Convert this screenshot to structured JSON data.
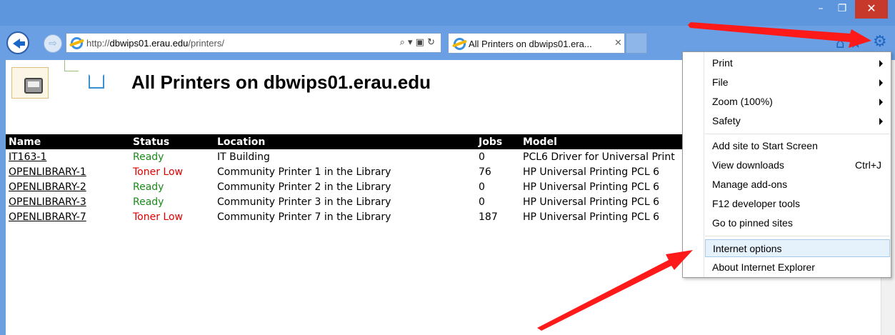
{
  "window": {
    "min_glyph": "–",
    "max_glyph": "❐",
    "close_glyph": "✕"
  },
  "nav": {
    "forward_glyph": "⇨",
    "url_prefix": "http://",
    "url_host": "dbwips01.erau.edu",
    "url_path": "/printers/",
    "address_tools": "⌕ ▾ ▣ ↻"
  },
  "tab": {
    "label": "All Printers on dbwips01.era...",
    "close_glyph": "✕"
  },
  "toolbar": {
    "icons": "⌂ ★",
    "gear_glyph": "⚙"
  },
  "page": {
    "title": "All Printers on dbwips01.erau.edu"
  },
  "table": {
    "headers": {
      "name": "Name",
      "status": "Status",
      "location": "Location",
      "jobs": "Jobs",
      "model": "Model"
    },
    "rows": [
      {
        "name": "IT163-1",
        "status": "Ready",
        "location": "IT Building",
        "jobs": "0",
        "model": "PCL6 Driver for Universal Print"
      },
      {
        "name": "OPENLIBRARY-1",
        "status": "Toner Low",
        "location": "Community Printer 1 in the Library",
        "jobs": "76",
        "model": "HP Universal Printing PCL 6"
      },
      {
        "name": "OPENLIBRARY-2",
        "status": "Ready",
        "location": "Community Printer 2 in the Library",
        "jobs": "0",
        "model": "HP Universal Printing PCL 6"
      },
      {
        "name": "OPENLIBRARY-3",
        "status": "Ready",
        "location": "Community Printer 3 in the Library",
        "jobs": "0",
        "model": "HP Universal Printing PCL 6"
      },
      {
        "name": "OPENLIBRARY-7",
        "status": "Toner Low",
        "location": "Community Printer 7 in the Library",
        "jobs": "187",
        "model": "HP Universal Printing PCL 6"
      }
    ]
  },
  "menu": {
    "print": "Print",
    "file": "File",
    "zoom": "Zoom (100%)",
    "safety": "Safety",
    "add_site": "Add site to Start Screen",
    "view_downloads": "View downloads",
    "view_downloads_shortcut": "Ctrl+J",
    "manage_addons": "Manage add-ons",
    "f12": "F12 developer tools",
    "pinned": "Go to pinned sites",
    "internet_options": "Internet options",
    "about": "About Internet Explorer"
  },
  "colors": {
    "ready": "#1a8a1a",
    "toner_low": "#e00000",
    "annotation_arrow": "#ff1a1a"
  }
}
